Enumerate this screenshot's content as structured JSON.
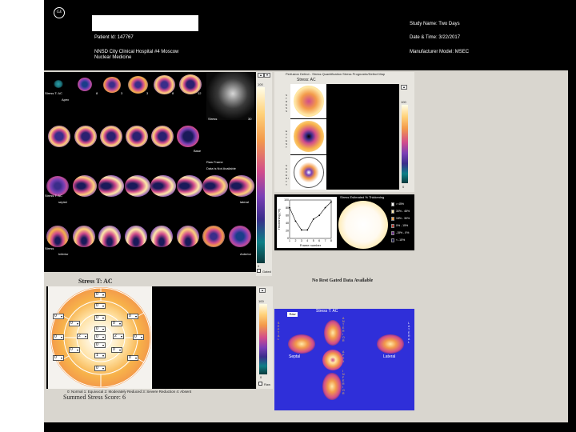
{
  "header": {
    "logo_text": "GE",
    "patient_id": "Patient Id: 147767",
    "hospital_line1": "NNSD City Clinical Hospital #4 Moscow",
    "hospital_line2": "Nuclear Medicine",
    "study_name": "Study Name: Two Days",
    "date_time": "Date & Time: 3/22/2017",
    "manufacturer": "Manufacturer Model: MSEC"
  },
  "slices_panel": {
    "label_stress_ac": "Stress T: AC",
    "label_apex": "Apex",
    "slice_numbers": [
      "8",
      "3",
      "3",
      "8",
      "12",
      "5"
    ],
    "label_base": "Base",
    "label_stress_vla": "Stress T: AC",
    "label_septal": "septal",
    "label_lateral": "lateral",
    "label_stress_hla": "Stress",
    "label_inferior": "Inferior",
    "label_anterior": "Anterior",
    "label_stress_s2": "Stress",
    "label_s2_num": "30",
    "no_frame_text": "Raw Frame",
    "no_frame_text2": "Data is Not Available",
    "colorbar_top": "100",
    "colorbar_bottom": "0",
    "gated_checkbox_label": "Gated"
  },
  "polar_panel": {
    "title": "Stress T: AC",
    "legend": "0: Normal   1: Equivocal   2: Moderately Reduced   3: Severe Reduction   4: Absent",
    "summed_score": "Summed Stress Score: 6",
    "segment_scores": [
      "0",
      "0",
      "0",
      "0",
      "0",
      "0",
      "0",
      "0",
      "2",
      "0",
      "2",
      "0",
      "0",
      "0",
      "0",
      "0",
      "1",
      "0",
      "0",
      "0"
    ],
    "colorbar_top": "100",
    "colorbar_bottom": "0",
    "checkbox_label": "Raw"
  },
  "bullseye_panel": {
    "header_text": "Perfusion Defect - Stress Quantification Stress Prognostic/Defect Map",
    "title": "Stress: AC",
    "colorbar_top": "100",
    "colorbar_bottom": "0",
    "row_labels": [
      "S T R E S S",
      "E X T E N T",
      "S E V E R I T Y"
    ]
  },
  "gated_panel": {
    "no_gated_text": "No Rest Gated Data Available",
    "chart_title": "Stress Estimated % Thickening",
    "y_label": "Thickening (%)",
    "x_label": "Frame number",
    "legend_items": [
      "> 45%",
      "30% - 45%",
      "15% - 30%",
      "0% - 15%",
      "-15% - 0%",
      "< -15%"
    ],
    "legend_colors": [
      "#ffffff",
      "#ffe9a8",
      "#f7a445",
      "#c0392b",
      "#6a2a8a",
      "#1a1a4a"
    ]
  },
  "threed_panel": {
    "title": "Stress T: AC",
    "tag": "Raw",
    "label_septal": "Septal",
    "label_lateral": "Lateral",
    "label_anterior": "A N T E R I O R",
    "label_apex": "A P E X",
    "label_inferior": "I N F E R I O R",
    "label_left": "S E P T A L",
    "label_right": "L A T E R A L",
    "colorbar_top": "100",
    "colorbar_bottom": "0"
  },
  "chart_data": {
    "type": "line",
    "title": "Stress Estimated % Thickening",
    "xlabel": "Frame number",
    "ylabel": "Thickening (%)",
    "x": [
      1,
      2,
      3,
      4,
      5,
      6,
      7,
      8
    ],
    "values": [
      80,
      45,
      22,
      22,
      50,
      60,
      80,
      95
    ],
    "ylim": [
      0,
      100
    ],
    "x_ticks": [
      "1",
      "2",
      "3",
      "4",
      "5",
      "6",
      "7",
      "8"
    ],
    "y_ticks": [
      "100",
      "80",
      "60",
      "40",
      "20",
      "0"
    ]
  }
}
